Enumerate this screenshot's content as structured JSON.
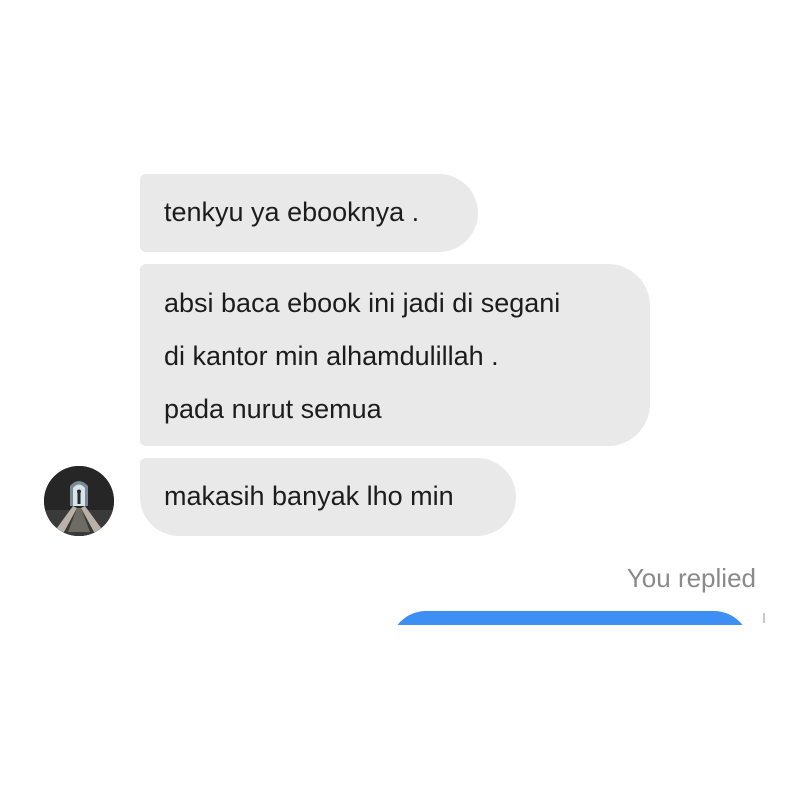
{
  "conversation": {
    "messages": [
      {
        "lines": [
          "tenkyu ya ebooknya ."
        ]
      },
      {
        "lines": [
          "absi baca ebook ini jadi di segani",
          "di kantor min alhamdulillah .",
          "pada nurut semua"
        ]
      },
      {
        "lines": [
          "makasih banyak lho min"
        ]
      }
    ],
    "sender_avatar": {
      "icon": "doorway-figure-icon"
    },
    "reply_label": "You replied",
    "reply_bubble_color": "#3e8ff3",
    "incoming_bubble_color": "#e9e9e9"
  }
}
